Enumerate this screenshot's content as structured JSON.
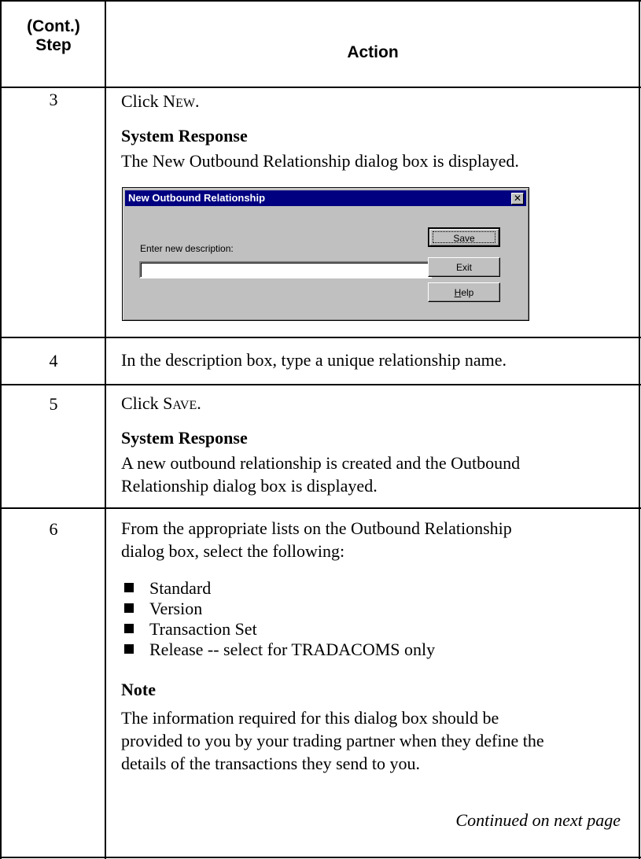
{
  "header": {
    "step_line1": "(Cont.)",
    "step_line2": "Step",
    "action": "Action"
  },
  "rows": [
    {
      "step": "3",
      "click_prefix": "Click ",
      "click_target_first": "N",
      "click_target_rest": "EW",
      "click_suffix": ".",
      "response_heading": "System Response",
      "response_text": "The New Outbound Relationship dialog box is displayed."
    },
    {
      "step": "4",
      "text": "In the description box, type a unique relationship name."
    },
    {
      "step": "5",
      "click_prefix": "Click ",
      "click_target_first": "S",
      "click_target_rest": "AVE",
      "click_suffix": ".",
      "response_heading": "System Response",
      "response_line1": "A new outbound relationship is created and the Outbound",
      "response_line2": "Relationship dialog box is displayed."
    },
    {
      "step": "6",
      "intro_line1": "From the appropriate lists on the Outbound Relationship",
      "intro_line2": "dialog box, select the following:",
      "bullets": [
        "Standard",
        "Version",
        "Transaction Set",
        "Release -- select for TRADACOMS only"
      ],
      "note_heading": "Note",
      "note_line1": "The information required for this dialog box should be",
      "note_line2": "provided to you by your trading partner when they define the",
      "note_line3": "details of the transactions they send to you."
    }
  ],
  "continued": "Continued on next page",
  "dialog": {
    "title": "New Outbound Relationship",
    "close_glyph": "✕",
    "label": "Enter new description:",
    "input_value": "",
    "buttons": {
      "save": "Save",
      "exit": "Exit",
      "help_first": "H",
      "help_rest": "elp"
    }
  }
}
